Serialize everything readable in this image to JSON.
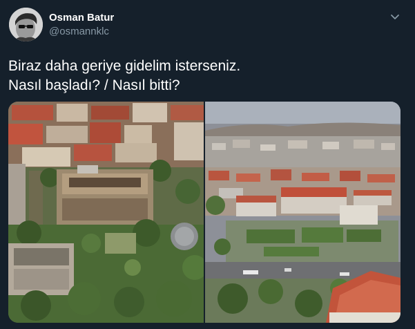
{
  "tweet": {
    "author": {
      "display_name": "Osman Batur",
      "handle": "@osmannklc",
      "avatar_icon": "avatar-photo"
    },
    "text_lines": [
      "Biraz daha geriye gidelim isterseniz.",
      "Nasıl başladı? / Nasıl bitti?"
    ],
    "menu_icon": "chevron-down-icon",
    "media": [
      {
        "subject": "old-city-aerial-photo"
      },
      {
        "subject": "modern-city-aerial-photo"
      }
    ]
  },
  "colors": {
    "background": "#15202b",
    "text_primary": "#ffffff",
    "text_secondary": "#8899a6"
  }
}
